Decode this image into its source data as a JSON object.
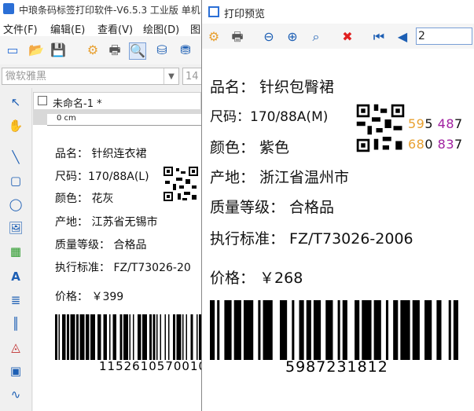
{
  "app": {
    "title": "中琅条码标签打印软件-V6.5.3 工业版 单机",
    "menu": [
      "文件(F)",
      "编辑(E)",
      "查看(V)",
      "绘图(D)",
      "图"
    ],
    "font_name": "微软雅黑",
    "font_size": "14",
    "doc_tab": "未命名-1 *",
    "ruler_unit": "0 cm"
  },
  "small_label": {
    "name": "品名：  针织连衣裙",
    "size": "尺码：170/88A(L)",
    "color": "颜色：  花灰",
    "origin": "产地：  江苏省无锡市",
    "grade": "质量等级：  合格品",
    "standard": "执行标准：  FZ/T73026-20",
    "price": "价格：  ￥399",
    "barcode": "1152610570010"
  },
  "preview": {
    "title": "打印预览",
    "page": "2",
    "name": "品名：  针织包臀裙",
    "size": "尺码：170/88A(M)",
    "color": "颜色：  紫色",
    "origin": "产地：  浙江省温州市",
    "grade": "质量等级：  合格品",
    "standard": "执行标准：  FZ/T73026-2006",
    "price": "价格：  ￥268",
    "num_line1": "595  487",
    "num_line2": "680  837",
    "barcode": "5987231812"
  },
  "colors": {
    "orange": "#e8a030",
    "purple": "#a020a0",
    "accent": "#1d5fb4"
  }
}
